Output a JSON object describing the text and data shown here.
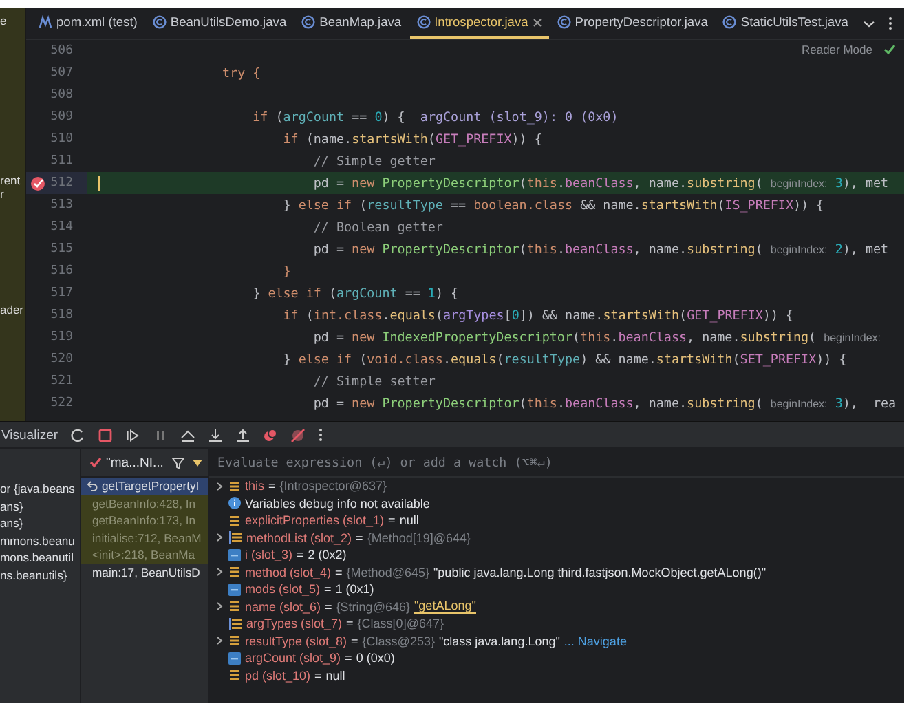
{
  "project_fragments": [
    "e",
    "rent",
    "r",
    "ader"
  ],
  "tabs": [
    {
      "label": "pom.xml (test)",
      "kind": "maven",
      "selected": false
    },
    {
      "label": "BeanUtilsDemo.java",
      "kind": "class",
      "selected": false
    },
    {
      "label": "BeanMap.java",
      "kind": "class",
      "selected": false
    },
    {
      "label": "Introspector.java",
      "kind": "class",
      "selected": true
    },
    {
      "label": "PropertyDescriptor.java",
      "kind": "class",
      "selected": false
    },
    {
      "label": "StaticUtilsTest.java",
      "kind": "class",
      "selected": false
    }
  ],
  "reader_mode": "Reader Mode",
  "code_lines": [
    {
      "number": "506",
      "current": false
    },
    {
      "number": "507",
      "current": false,
      "tokens": [
        {
          "text": "                try",
          "kind": "kw"
        },
        {
          "text": " {",
          "kind": "brace"
        }
      ]
    },
    {
      "number": "508",
      "current": false
    },
    {
      "number": "509",
      "current": false,
      "tokens": [
        {
          "text": "                    if",
          "kind": "kw"
        },
        {
          "text": " (",
          "kind": "plain"
        },
        {
          "text": "argCount",
          "kind": "local"
        },
        {
          "text": " == ",
          "kind": "plain"
        },
        {
          "text": "0",
          "kind": "num"
        },
        {
          "text": ") {",
          "kind": "plain"
        },
        {
          "text": "  argCount (slot_9): 0 (0x0)",
          "kind": "inline"
        }
      ]
    },
    {
      "number": "510",
      "current": false,
      "tokens": [
        {
          "text": "                        if",
          "kind": "kw"
        },
        {
          "text": " (name.",
          "kind": "plain"
        },
        {
          "text": "startsWith",
          "kind": "method"
        },
        {
          "text": "(",
          "kind": "plain"
        },
        {
          "text": "GET_PREFIX",
          "kind": "const"
        },
        {
          "text": ")) {",
          "kind": "plain"
        }
      ]
    },
    {
      "number": "511",
      "current": false,
      "tokens": [
        {
          "text": "                            // Simple getter",
          "kind": "comment"
        }
      ]
    },
    {
      "number": "512",
      "current": true,
      "tokens": [
        {
          "text": "                            pd = ",
          "kind": "plain"
        },
        {
          "text": "new",
          "kind": "kw"
        },
        {
          "text": " PropertyDescriptor",
          "kind": "cls"
        },
        {
          "text": "(",
          "kind": "plain"
        },
        {
          "text": "this",
          "kind": "kw"
        },
        {
          "text": ".",
          "kind": "plain"
        },
        {
          "text": "beanClass",
          "kind": "field"
        },
        {
          "text": ", name.",
          "kind": "plain"
        },
        {
          "text": "substring",
          "kind": "method"
        },
        {
          "text": "( ",
          "kind": "plain"
        },
        {
          "text": "beginIndex:",
          "kind": "hint"
        },
        {
          "text": " 3",
          "kind": "num"
        },
        {
          "text": "), met",
          "kind": "plain"
        }
      ]
    },
    {
      "number": "513",
      "current": false,
      "tokens": [
        {
          "text": "                        } ",
          "kind": "plain"
        },
        {
          "text": "else if",
          "kind": "kw"
        },
        {
          "text": " (",
          "kind": "plain"
        },
        {
          "text": "resultType",
          "kind": "local"
        },
        {
          "text": " == ",
          "kind": "plain"
        },
        {
          "text": "boolean.class",
          "kind": "kw"
        },
        {
          "text": " && name.",
          "kind": "plain"
        },
        {
          "text": "startsWith",
          "kind": "method"
        },
        {
          "text": "(",
          "kind": "plain"
        },
        {
          "text": "IS_PREFIX",
          "kind": "const"
        },
        {
          "text": ")) {",
          "kind": "plain"
        }
      ]
    },
    {
      "number": "514",
      "current": false,
      "tokens": [
        {
          "text": "                            // Boolean getter",
          "kind": "comment"
        }
      ]
    },
    {
      "number": "515",
      "current": false,
      "tokens": [
        {
          "text": "                            pd = ",
          "kind": "plain"
        },
        {
          "text": "new",
          "kind": "kw"
        },
        {
          "text": " PropertyDescriptor",
          "kind": "cls"
        },
        {
          "text": "(",
          "kind": "plain"
        },
        {
          "text": "this",
          "kind": "kw"
        },
        {
          "text": ".",
          "kind": "plain"
        },
        {
          "text": "beanClass",
          "kind": "field"
        },
        {
          "text": ", name.",
          "kind": "plain"
        },
        {
          "text": "substring",
          "kind": "method"
        },
        {
          "text": "( ",
          "kind": "plain"
        },
        {
          "text": "beginIndex:",
          "kind": "hint"
        },
        {
          "text": " 2",
          "kind": "num"
        },
        {
          "text": "), met",
          "kind": "plain"
        }
      ]
    },
    {
      "number": "516",
      "current": false,
      "tokens": [
        {
          "text": "                        }",
          "kind": "brace"
        }
      ]
    },
    {
      "number": "517",
      "current": false,
      "tokens": [
        {
          "text": "                    } ",
          "kind": "plain"
        },
        {
          "text": "else if",
          "kind": "kw"
        },
        {
          "text": " (",
          "kind": "plain"
        },
        {
          "text": "argCount",
          "kind": "local"
        },
        {
          "text": " == ",
          "kind": "plain"
        },
        {
          "text": "1",
          "kind": "num"
        },
        {
          "text": ") {",
          "kind": "plain"
        }
      ]
    },
    {
      "number": "518",
      "current": false,
      "tokens": [
        {
          "text": "                        if",
          "kind": "kw"
        },
        {
          "text": " (",
          "kind": "plain"
        },
        {
          "text": "int.class",
          "kind": "kw"
        },
        {
          "text": ".",
          "kind": "plain"
        },
        {
          "text": "equals",
          "kind": "method"
        },
        {
          "text": "(",
          "kind": "plain"
        },
        {
          "text": "argTypes",
          "kind": "param"
        },
        {
          "text": "[",
          "kind": "plain"
        },
        {
          "text": "0",
          "kind": "num"
        },
        {
          "text": "]) && name.",
          "kind": "plain"
        },
        {
          "text": "startsWith",
          "kind": "method"
        },
        {
          "text": "(",
          "kind": "plain"
        },
        {
          "text": "GET_PREFIX",
          "kind": "const"
        },
        {
          "text": ")) {",
          "kind": "plain"
        }
      ]
    },
    {
      "number": "519",
      "current": false,
      "tokens": [
        {
          "text": "                            pd = ",
          "kind": "plain"
        },
        {
          "text": "new",
          "kind": "kw"
        },
        {
          "text": " IndexedPropertyDescriptor",
          "kind": "cls"
        },
        {
          "text": "(",
          "kind": "plain"
        },
        {
          "text": "this",
          "kind": "kw"
        },
        {
          "text": ".",
          "kind": "plain"
        },
        {
          "text": "beanClass",
          "kind": "field"
        },
        {
          "text": ", name.",
          "kind": "plain"
        },
        {
          "text": "substring",
          "kind": "method"
        },
        {
          "text": "( ",
          "kind": "plain"
        },
        {
          "text": "beginIndex:",
          "kind": "hint"
        }
      ]
    },
    {
      "number": "520",
      "current": false,
      "tokens": [
        {
          "text": "                        } ",
          "kind": "plain"
        },
        {
          "text": "else if",
          "kind": "kw"
        },
        {
          "text": " (",
          "kind": "plain"
        },
        {
          "text": "void.class",
          "kind": "kw"
        },
        {
          "text": ".",
          "kind": "plain"
        },
        {
          "text": "equals",
          "kind": "method"
        },
        {
          "text": "(",
          "kind": "plain"
        },
        {
          "text": "resultType",
          "kind": "local"
        },
        {
          "text": ") && name.",
          "kind": "plain"
        },
        {
          "text": "startsWith",
          "kind": "method"
        },
        {
          "text": "(",
          "kind": "plain"
        },
        {
          "text": "SET_PREFIX",
          "kind": "const"
        },
        {
          "text": ")) {",
          "kind": "plain"
        }
      ]
    },
    {
      "number": "521",
      "current": false,
      "tokens": [
        {
          "text": "                            // Simple setter",
          "kind": "comment"
        }
      ]
    },
    {
      "number": "522",
      "current": false,
      "tokens": [
        {
          "text": "                            pd = ",
          "kind": "plain"
        },
        {
          "text": "new",
          "kind": "kw"
        },
        {
          "text": " PropertyDescriptor",
          "kind": "cls"
        },
        {
          "text": "(",
          "kind": "plain"
        },
        {
          "text": "this",
          "kind": "kw"
        },
        {
          "text": ".",
          "kind": "plain"
        },
        {
          "text": "beanClass",
          "kind": "field"
        },
        {
          "text": ", name.",
          "kind": "plain"
        },
        {
          "text": "substring",
          "kind": "method"
        },
        {
          "text": "( ",
          "kind": "plain"
        },
        {
          "text": "beginIndex:",
          "kind": "hint"
        },
        {
          "text": " 3",
          "kind": "num"
        },
        {
          "text": "),  rea",
          "kind": "plain"
        }
      ]
    }
  ],
  "debug_toolbar": {
    "title": "Visualizer"
  },
  "thread": {
    "label": "\"ma...NI..."
  },
  "structure_fragments": [
    "or {java.beans",
    "ans}",
    "ans}",
    "mmons.beanu",
    "mons.beanutil",
    "ns.beanutils}"
  ],
  "frames": [
    {
      "label": "getTargetPropertyI",
      "selected": true,
      "library": false
    },
    {
      "label": "getBeanInfo:428, In",
      "selected": false,
      "library": true
    },
    {
      "label": "getBeanInfo:173, In",
      "selected": false,
      "library": true
    },
    {
      "label": "initialise:712, BeanM",
      "selected": false,
      "library": true
    },
    {
      "label": "<init>:218, BeanMa",
      "selected": false,
      "library": true
    },
    {
      "label": "main:17, BeanUtilsD",
      "selected": false,
      "library": false
    }
  ],
  "evaluate": {
    "placeholder": "Evaluate expression (↵) or add a watch (⌥⌘↵)"
  },
  "variables": [
    {
      "kind": "object",
      "expandable": true,
      "name": "this",
      "sep": "=",
      "value": "{Introspector@637}"
    },
    {
      "kind": "info",
      "expandable": false,
      "name": "Variables debug info not available"
    },
    {
      "kind": "object",
      "expandable": false,
      "name": "explicitProperties (slot_1)",
      "sep": "=",
      "plain": "null"
    },
    {
      "kind": "array",
      "expandable": true,
      "name": "methodList (slot_2)",
      "sep": "=",
      "value": "{Method[19]@644}"
    },
    {
      "kind": "primitive",
      "expandable": false,
      "name": "i (slot_3)",
      "sep": "=",
      "plain": "2 (0x2)"
    },
    {
      "kind": "object",
      "expandable": true,
      "name": "method (slot_4)",
      "sep": "=",
      "value": "{Method@645}",
      "string": "\"public java.lang.Long third.fastjson.MockObject.getALong()\"",
      "string_highlighted": false
    },
    {
      "kind": "primitive",
      "expandable": false,
      "name": "mods (slot_5)",
      "sep": "=",
      "plain": "1 (0x1)"
    },
    {
      "kind": "object",
      "expandable": true,
      "name": "name (slot_6)",
      "sep": "=",
      "value": "{String@646}",
      "string": "\"getALong\"",
      "string_highlighted": true
    },
    {
      "kind": "array",
      "expandable": false,
      "name": "argTypes (slot_7)",
      "sep": "=",
      "value": "{Class[0]@647}"
    },
    {
      "kind": "object",
      "expandable": true,
      "name": "resultType (slot_8)",
      "sep": "=",
      "value": "{Class@253}",
      "string": "\"class java.lang.Long\"",
      "string_highlighted": false,
      "link": "... Navigate"
    },
    {
      "kind": "primitive",
      "expandable": false,
      "name": "argCount (slot_9)",
      "sep": "=",
      "plain": "0 (0x0)"
    },
    {
      "kind": "object",
      "expandable": false,
      "name": "pd (slot_10)",
      "sep": "=",
      "plain": "null"
    }
  ]
}
